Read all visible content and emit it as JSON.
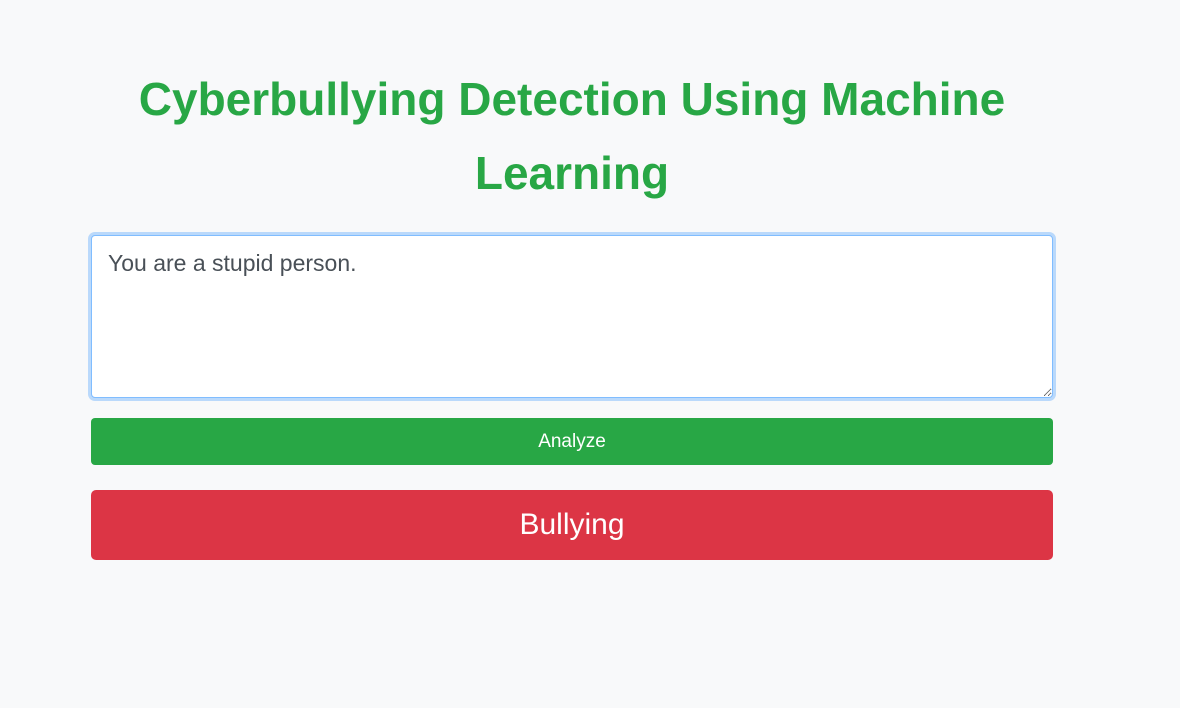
{
  "page": {
    "title": "Cyberbullying Detection Using Machine Learning"
  },
  "input": {
    "value": "You are a stupid person."
  },
  "analyze_button": {
    "label": "Analyze"
  },
  "result": {
    "label": "Bullying"
  },
  "colors": {
    "title": "#28a745",
    "analyze_button": "#28a745",
    "result_background": "#dc3545",
    "page_background": "#f8f9fa"
  }
}
